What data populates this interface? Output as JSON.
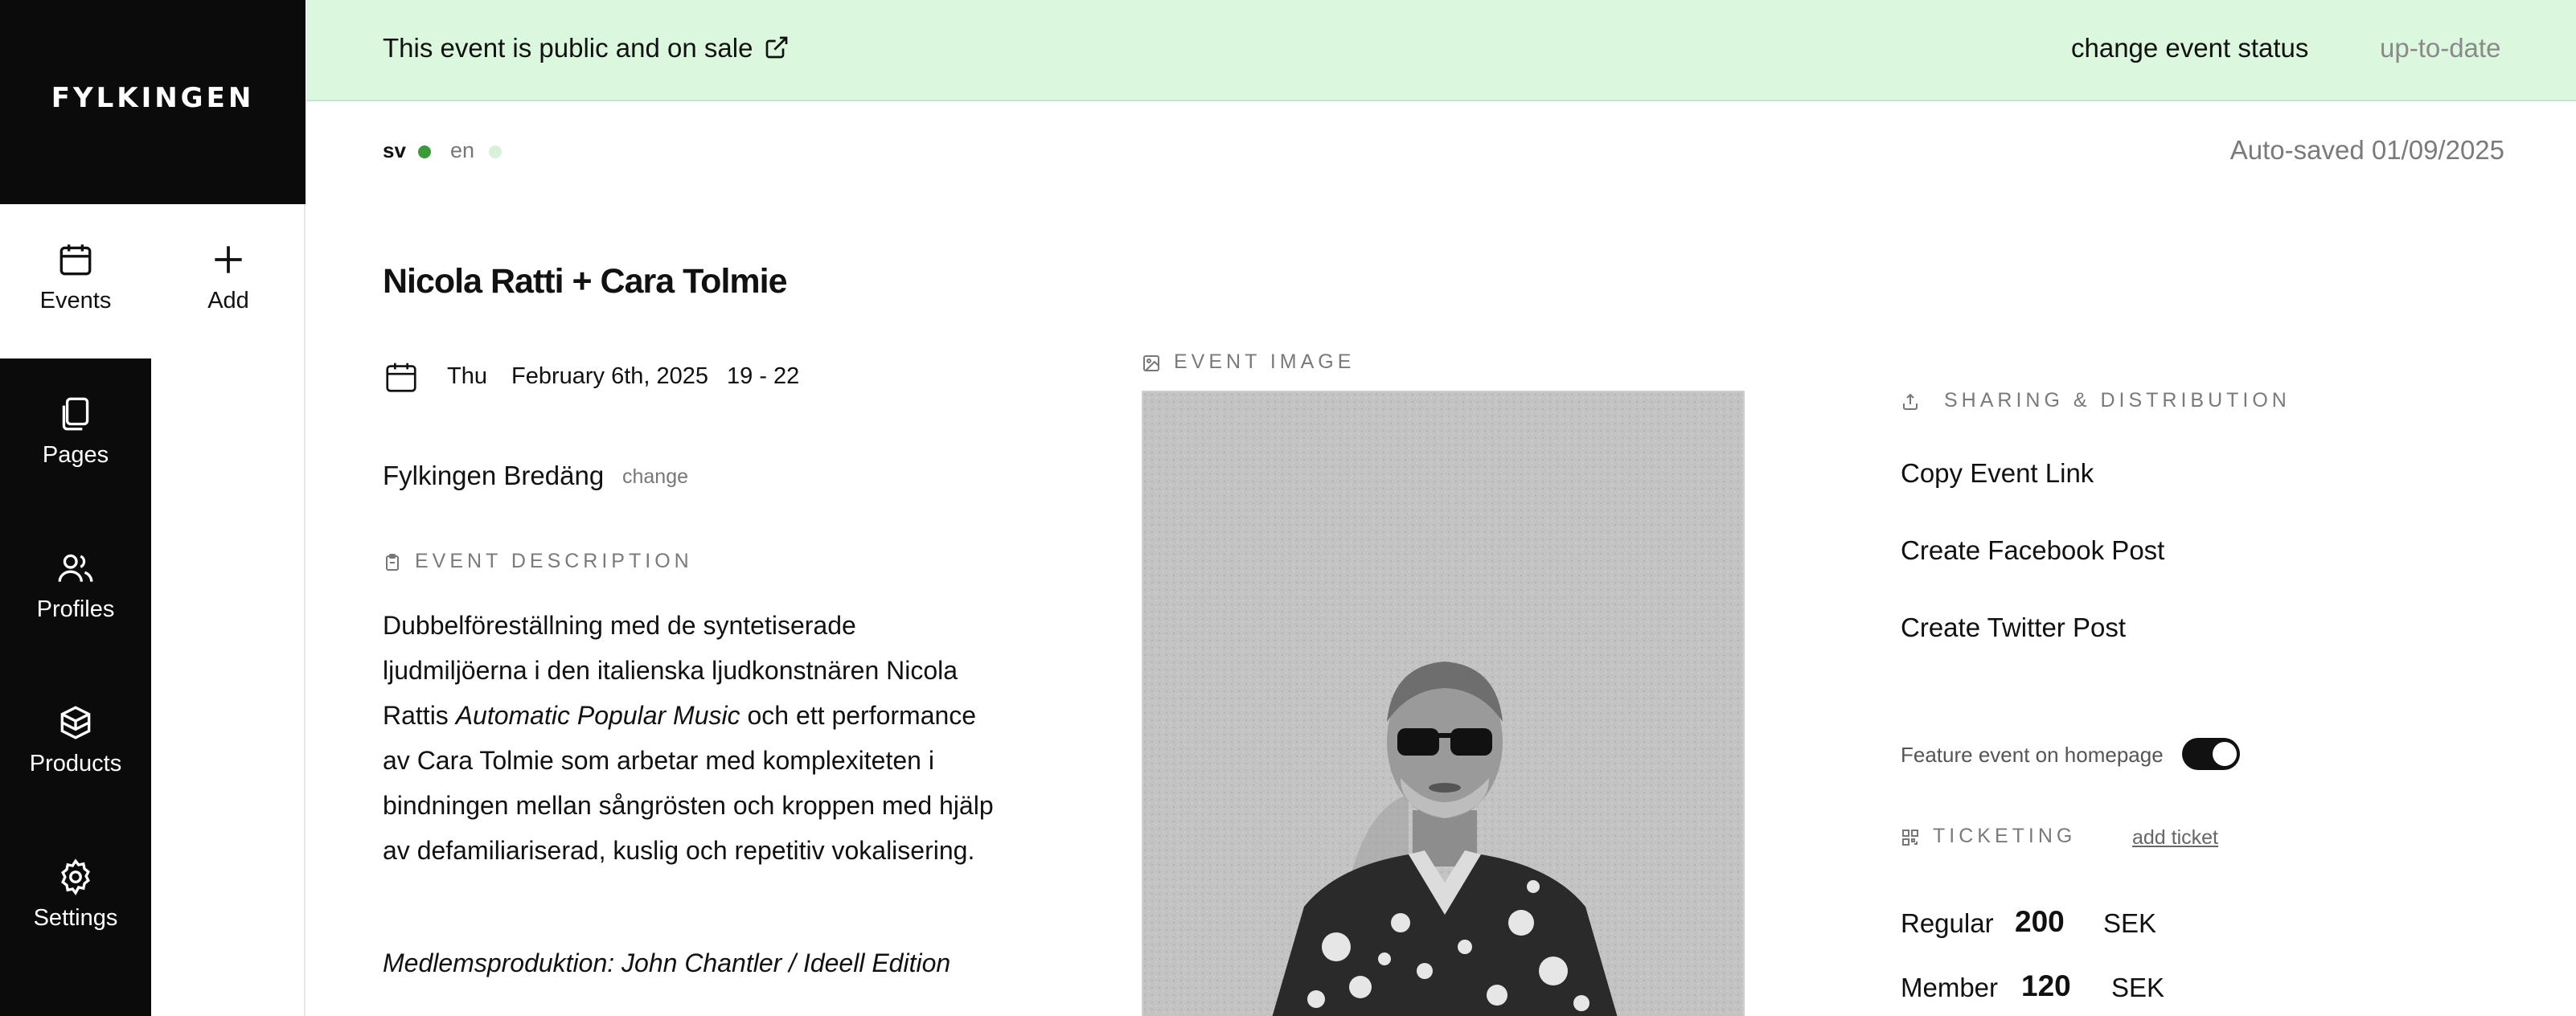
{
  "sidebar": {
    "logo": "FYLKINGEN",
    "items": [
      {
        "label": "Events",
        "icon": "calendar-icon"
      },
      {
        "label": "Add",
        "icon": "plus-icon"
      },
      {
        "label": "Pages",
        "icon": "pages-icon"
      },
      {
        "label": "Profiles",
        "icon": "users-icon"
      },
      {
        "label": "Products",
        "icon": "box-icon"
      },
      {
        "label": "Settings",
        "icon": "gear-icon"
      }
    ]
  },
  "status_bar": {
    "text": "This event is public and on sale",
    "change_status": "change event status",
    "sync_state": "up-to-date",
    "background_color": "#dbf7de"
  },
  "languages": {
    "sv": "sv",
    "en": "en"
  },
  "autosaved": "Auto-saved 01/09/2025",
  "event": {
    "title": "Nicola Ratti + Cara Tolmie",
    "day": "Thu",
    "date": "February 6th, 2025",
    "time": "19 - 22",
    "venue": "Fylkingen Bredäng",
    "venue_change": "change",
    "description_label": "EVENT DESCRIPTION",
    "description_before": "Dubbelföreställning med de syntetiserade ljudmiljöerna i den italienska ljudkonstnären Nicola Rattis ",
    "description_italic": "Automatic Popular Music",
    "description_after": " och ett performance av Cara Tolmie som arbetar med komplexiteten i bindningen mellan sångrösten och kroppen med hjälp av defamiliariserad, kuslig och repetitiv vokalisering.",
    "credit": "Medlemsproduktion: John Chantler / Ideell Edition"
  },
  "image": {
    "label": "EVENT IMAGE"
  },
  "sharing": {
    "label": "SHARING & DISTRIBUTION",
    "links": [
      "Copy Event Link",
      "Create Facebook Post",
      "Create Twitter Post"
    ],
    "feature_label": "Feature event on homepage",
    "feature_enabled": true
  },
  "ticketing": {
    "label": "TICKETING",
    "add_ticket": "add ticket",
    "tickets": [
      {
        "name": "Regular",
        "price": "200",
        "currency": "SEK"
      },
      {
        "name": "Member",
        "price": "120",
        "currency": "SEK"
      }
    ]
  }
}
